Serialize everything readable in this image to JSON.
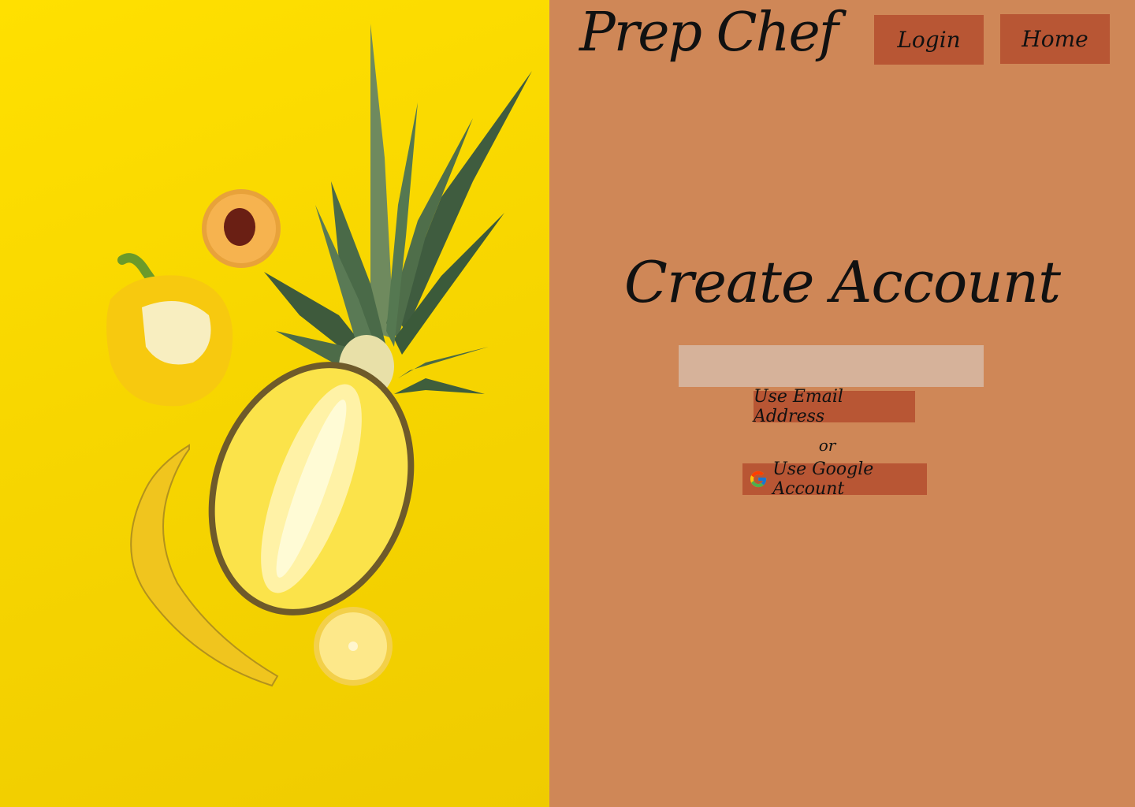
{
  "brand": {
    "name": "Prep Chef"
  },
  "nav": {
    "login_label": "Login",
    "home_label": "Home"
  },
  "hero_image": {
    "subject": "yellow fruits and vegetables on a yellow background"
  },
  "signup": {
    "title": "Create Account",
    "email_input": {
      "value": "",
      "placeholder": ""
    },
    "email_button_label": "Use Email Address",
    "or_label": "or",
    "google_button_label": "Use Google Account",
    "google_icon": "google-g-icon"
  },
  "colors": {
    "panel_background": "#cf8757",
    "button_background": "#b85634",
    "input_background": "#d6b29a",
    "image_background": "#f7d600"
  }
}
